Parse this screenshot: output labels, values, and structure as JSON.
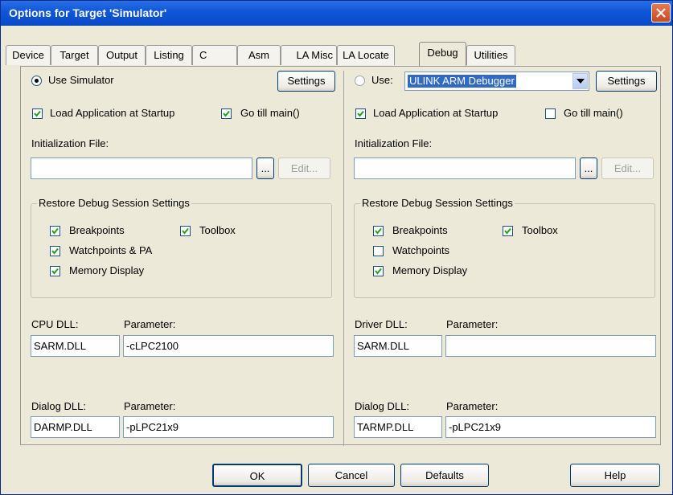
{
  "window": {
    "title": "Options for Target 'Simulator'"
  },
  "tabs": [
    {
      "label": "Device"
    },
    {
      "label": "Target"
    },
    {
      "label": "Output"
    },
    {
      "label": "Listing"
    },
    {
      "label": "C"
    },
    {
      "label": "Asm"
    },
    {
      "label": "LA Misc"
    },
    {
      "label": "LA Locate"
    },
    {
      "label": "Debug"
    },
    {
      "label": "Utilities"
    }
  ],
  "active_tab": "Debug",
  "left": {
    "mode_label": "Use Simulator",
    "mode_selected": true,
    "settings_label": "Settings",
    "load_app_label": "Load Application at Startup",
    "load_app_checked": true,
    "go_main_label": "Go  till main()",
    "go_main_checked": true,
    "init_file_label": "Initialization File:",
    "init_file_value": "",
    "browse_label": "...",
    "edit_label": "Edit...",
    "restore_title": "Restore Debug Session Settings",
    "breakpoints_label": "Breakpoints",
    "toolbox_label": "Toolbox",
    "watchpoints_label": "Watchpoints & PA",
    "memory_label": "Memory Display",
    "cpu_dll_label": "CPU DLL:",
    "cpu_dll_value": "SARM.DLL",
    "cpu_param_label": "Parameter:",
    "cpu_param_value": "-cLPC2100",
    "dialog_dll_label": "Dialog DLL:",
    "dialog_dll_value": "DARMP.DLL",
    "dialog_param_label": "Parameter:",
    "dialog_param_value": "-pLPC21x9"
  },
  "right": {
    "use_label": "Use:",
    "use_selected": false,
    "debugger_value": "ULINK ARM Debugger",
    "settings_label": "Settings",
    "load_app_label": "Load Application at Startup",
    "load_app_checked": true,
    "go_main_label": "Go  till main()",
    "go_main_checked": false,
    "init_file_label": "Initialization File:",
    "init_file_value": "",
    "browse_label": "...",
    "edit_label": "Edit...",
    "restore_title": "Restore Debug Session Settings",
    "breakpoints_label": "Breakpoints",
    "toolbox_label": "Toolbox",
    "watchpoints_label": "Watchpoints",
    "memory_label": "Memory Display",
    "driver_dll_label": "Driver DLL:",
    "driver_dll_value": "SARM.DLL",
    "driver_param_label": "Parameter:",
    "driver_param_value": "",
    "dialog_dll_label": "Dialog DLL:",
    "dialog_dll_value": "TARMP.DLL",
    "dialog_param_label": "Parameter:",
    "dialog_param_value": "-pLPC21x9"
  },
  "buttons": {
    "ok": "OK",
    "cancel": "Cancel",
    "defaults": "Defaults",
    "help": "Help"
  },
  "colors": {
    "titlebar": "#0e56d8",
    "dialog_bg": "#ece9d8",
    "selection": "#316ac5",
    "close": "#d9552a"
  },
  "icons": {
    "close": "close-icon",
    "check": "checkmark-icon",
    "dropdown": "chevron-down-icon"
  }
}
